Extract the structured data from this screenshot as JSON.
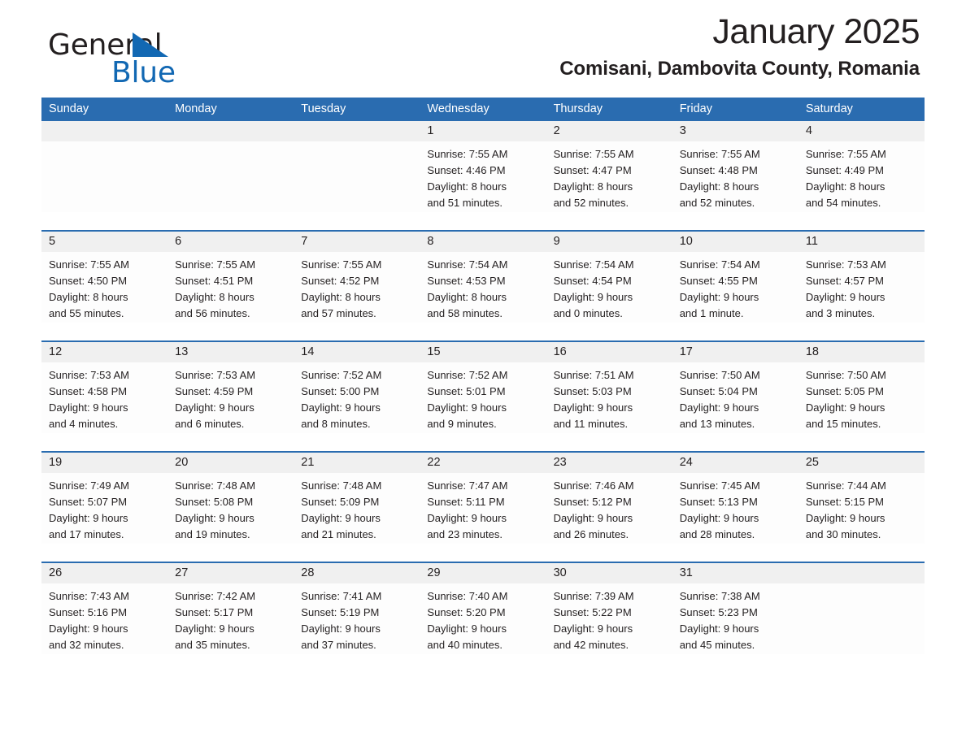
{
  "brand": {
    "name_part1": "General",
    "name_part2": "Blue",
    "accent_color": "#1268b3",
    "triangle_icon": "triangle-icon"
  },
  "header": {
    "month_title": "January 2025",
    "location": "Comisani, Dambovita County, Romania"
  },
  "calendar": {
    "header_bg": "#2a6cb0",
    "day_names": [
      "Sunday",
      "Monday",
      "Tuesday",
      "Wednesday",
      "Thursday",
      "Friday",
      "Saturday"
    ],
    "weeks": [
      [
        {
          "date": "",
          "lines": []
        },
        {
          "date": "",
          "lines": []
        },
        {
          "date": "",
          "lines": []
        },
        {
          "date": "1",
          "lines": [
            "Sunrise: 7:55 AM",
            "Sunset: 4:46 PM",
            "Daylight: 8 hours",
            "and 51 minutes."
          ]
        },
        {
          "date": "2",
          "lines": [
            "Sunrise: 7:55 AM",
            "Sunset: 4:47 PM",
            "Daylight: 8 hours",
            "and 52 minutes."
          ]
        },
        {
          "date": "3",
          "lines": [
            "Sunrise: 7:55 AM",
            "Sunset: 4:48 PM",
            "Daylight: 8 hours",
            "and 52 minutes."
          ]
        },
        {
          "date": "4",
          "lines": [
            "Sunrise: 7:55 AM",
            "Sunset: 4:49 PM",
            "Daylight: 8 hours",
            "and 54 minutes."
          ]
        }
      ],
      [
        {
          "date": "5",
          "lines": [
            "Sunrise: 7:55 AM",
            "Sunset: 4:50 PM",
            "Daylight: 8 hours",
            "and 55 minutes."
          ]
        },
        {
          "date": "6",
          "lines": [
            "Sunrise: 7:55 AM",
            "Sunset: 4:51 PM",
            "Daylight: 8 hours",
            "and 56 minutes."
          ]
        },
        {
          "date": "7",
          "lines": [
            "Sunrise: 7:55 AM",
            "Sunset: 4:52 PM",
            "Daylight: 8 hours",
            "and 57 minutes."
          ]
        },
        {
          "date": "8",
          "lines": [
            "Sunrise: 7:54 AM",
            "Sunset: 4:53 PM",
            "Daylight: 8 hours",
            "and 58 minutes."
          ]
        },
        {
          "date": "9",
          "lines": [
            "Sunrise: 7:54 AM",
            "Sunset: 4:54 PM",
            "Daylight: 9 hours",
            "and 0 minutes."
          ]
        },
        {
          "date": "10",
          "lines": [
            "Sunrise: 7:54 AM",
            "Sunset: 4:55 PM",
            "Daylight: 9 hours",
            "and 1 minute."
          ]
        },
        {
          "date": "11",
          "lines": [
            "Sunrise: 7:53 AM",
            "Sunset: 4:57 PM",
            "Daylight: 9 hours",
            "and 3 minutes."
          ]
        }
      ],
      [
        {
          "date": "12",
          "lines": [
            "Sunrise: 7:53 AM",
            "Sunset: 4:58 PM",
            "Daylight: 9 hours",
            "and 4 minutes."
          ]
        },
        {
          "date": "13",
          "lines": [
            "Sunrise: 7:53 AM",
            "Sunset: 4:59 PM",
            "Daylight: 9 hours",
            "and 6 minutes."
          ]
        },
        {
          "date": "14",
          "lines": [
            "Sunrise: 7:52 AM",
            "Sunset: 5:00 PM",
            "Daylight: 9 hours",
            "and 8 minutes."
          ]
        },
        {
          "date": "15",
          "lines": [
            "Sunrise: 7:52 AM",
            "Sunset: 5:01 PM",
            "Daylight: 9 hours",
            "and 9 minutes."
          ]
        },
        {
          "date": "16",
          "lines": [
            "Sunrise: 7:51 AM",
            "Sunset: 5:03 PM",
            "Daylight: 9 hours",
            "and 11 minutes."
          ]
        },
        {
          "date": "17",
          "lines": [
            "Sunrise: 7:50 AM",
            "Sunset: 5:04 PM",
            "Daylight: 9 hours",
            "and 13 minutes."
          ]
        },
        {
          "date": "18",
          "lines": [
            "Sunrise: 7:50 AM",
            "Sunset: 5:05 PM",
            "Daylight: 9 hours",
            "and 15 minutes."
          ]
        }
      ],
      [
        {
          "date": "19",
          "lines": [
            "Sunrise: 7:49 AM",
            "Sunset: 5:07 PM",
            "Daylight: 9 hours",
            "and 17 minutes."
          ]
        },
        {
          "date": "20",
          "lines": [
            "Sunrise: 7:48 AM",
            "Sunset: 5:08 PM",
            "Daylight: 9 hours",
            "and 19 minutes."
          ]
        },
        {
          "date": "21",
          "lines": [
            "Sunrise: 7:48 AM",
            "Sunset: 5:09 PM",
            "Daylight: 9 hours",
            "and 21 minutes."
          ]
        },
        {
          "date": "22",
          "lines": [
            "Sunrise: 7:47 AM",
            "Sunset: 5:11 PM",
            "Daylight: 9 hours",
            "and 23 minutes."
          ]
        },
        {
          "date": "23",
          "lines": [
            "Sunrise: 7:46 AM",
            "Sunset: 5:12 PM",
            "Daylight: 9 hours",
            "and 26 minutes."
          ]
        },
        {
          "date": "24",
          "lines": [
            "Sunrise: 7:45 AM",
            "Sunset: 5:13 PM",
            "Daylight: 9 hours",
            "and 28 minutes."
          ]
        },
        {
          "date": "25",
          "lines": [
            "Sunrise: 7:44 AM",
            "Sunset: 5:15 PM",
            "Daylight: 9 hours",
            "and 30 minutes."
          ]
        }
      ],
      [
        {
          "date": "26",
          "lines": [
            "Sunrise: 7:43 AM",
            "Sunset: 5:16 PM",
            "Daylight: 9 hours",
            "and 32 minutes."
          ]
        },
        {
          "date": "27",
          "lines": [
            "Sunrise: 7:42 AM",
            "Sunset: 5:17 PM",
            "Daylight: 9 hours",
            "and 35 minutes."
          ]
        },
        {
          "date": "28",
          "lines": [
            "Sunrise: 7:41 AM",
            "Sunset: 5:19 PM",
            "Daylight: 9 hours",
            "and 37 minutes."
          ]
        },
        {
          "date": "29",
          "lines": [
            "Sunrise: 7:40 AM",
            "Sunset: 5:20 PM",
            "Daylight: 9 hours",
            "and 40 minutes."
          ]
        },
        {
          "date": "30",
          "lines": [
            "Sunrise: 7:39 AM",
            "Sunset: 5:22 PM",
            "Daylight: 9 hours",
            "and 42 minutes."
          ]
        },
        {
          "date": "31",
          "lines": [
            "Sunrise: 7:38 AM",
            "Sunset: 5:23 PM",
            "Daylight: 9 hours",
            "and 45 minutes."
          ]
        },
        {
          "date": "",
          "lines": []
        }
      ]
    ]
  }
}
